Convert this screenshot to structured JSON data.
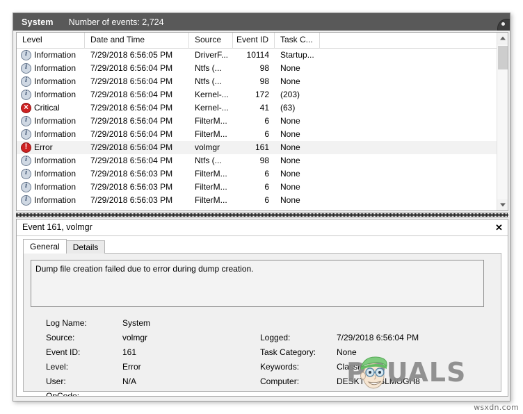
{
  "window": {
    "header": {
      "log_name": "System",
      "events_count_label": "Number of events: 2,724",
      "orb_icon": "dark-circle-icon"
    }
  },
  "events_list": {
    "columns": [
      {
        "key": "level",
        "label": "Level"
      },
      {
        "key": "date",
        "label": "Date and Time"
      },
      {
        "key": "source",
        "label": "Source"
      },
      {
        "key": "eid",
        "label": "Event ID"
      },
      {
        "key": "task",
        "label": "Task C..."
      }
    ],
    "rows": [
      {
        "level": "Information",
        "icon": "information-icon",
        "date": "7/29/2018 6:56:05 PM",
        "source": "DriverF...",
        "eid": "10114",
        "task": "Startup...",
        "selected": false
      },
      {
        "level": "Information",
        "icon": "information-icon",
        "date": "7/29/2018 6:56:04 PM",
        "source": "Ntfs (...",
        "eid": "98",
        "task": "None",
        "selected": false
      },
      {
        "level": "Information",
        "icon": "information-icon",
        "date": "7/29/2018 6:56:04 PM",
        "source": "Ntfs (...",
        "eid": "98",
        "task": "None",
        "selected": false
      },
      {
        "level": "Information",
        "icon": "information-icon",
        "date": "7/29/2018 6:56:04 PM",
        "source": "Kernel-...",
        "eid": "172",
        "task": "(203)",
        "selected": false
      },
      {
        "level": "Critical",
        "icon": "critical-icon",
        "date": "7/29/2018 6:56:04 PM",
        "source": "Kernel-...",
        "eid": "41",
        "task": "(63)",
        "selected": false
      },
      {
        "level": "Information",
        "icon": "information-icon",
        "date": "7/29/2018 6:56:04 PM",
        "source": "FilterM...",
        "eid": "6",
        "task": "None",
        "selected": false
      },
      {
        "level": "Information",
        "icon": "information-icon",
        "date": "7/29/2018 6:56:04 PM",
        "source": "FilterM...",
        "eid": "6",
        "task": "None",
        "selected": false
      },
      {
        "level": "Error",
        "icon": "error-icon",
        "date": "7/29/2018 6:56:04 PM",
        "source": "volmgr",
        "eid": "161",
        "task": "None",
        "selected": true
      },
      {
        "level": "Information",
        "icon": "information-icon",
        "date": "7/29/2018 6:56:04 PM",
        "source": "Ntfs (...",
        "eid": "98",
        "task": "None",
        "selected": false
      },
      {
        "level": "Information",
        "icon": "information-icon",
        "date": "7/29/2018 6:56:03 PM",
        "source": "FilterM...",
        "eid": "6",
        "task": "None",
        "selected": false
      },
      {
        "level": "Information",
        "icon": "information-icon",
        "date": "7/29/2018 6:56:03 PM",
        "source": "FilterM...",
        "eid": "6",
        "task": "None",
        "selected": false
      },
      {
        "level": "Information",
        "icon": "information-icon",
        "date": "7/29/2018 6:56:03 PM",
        "source": "FilterM...",
        "eid": "6",
        "task": "None",
        "selected": false
      }
    ]
  },
  "detail": {
    "title": "Event 161, volmgr",
    "close_label": "✕",
    "tabs": [
      {
        "label": "General",
        "active": true
      },
      {
        "label": "Details",
        "active": false
      }
    ],
    "message": "Dump file creation failed due to error during dump creation.",
    "properties_left": [
      {
        "label": "Log Name:",
        "value": "System"
      },
      {
        "label": "Source:",
        "value": "volmgr"
      },
      {
        "label": "Event ID:",
        "value": "161"
      },
      {
        "label": "Level:",
        "value": "Error"
      },
      {
        "label": "User:",
        "value": "N/A"
      },
      {
        "label": "OpCode:",
        "value": ""
      }
    ],
    "properties_right": [
      {
        "label": "",
        "value": ""
      },
      {
        "label": "Logged:",
        "value": "7/29/2018 6:56:04 PM"
      },
      {
        "label": "Task Category:",
        "value": "None"
      },
      {
        "label": "Keywords:",
        "value": "Classic"
      },
      {
        "label": "Computer:",
        "value": "DESKTOP-BLMOGH8"
      },
      {
        "label": "",
        "value": ""
      }
    ]
  },
  "watermark": {
    "text": "PPUALS",
    "mascot_icon": "appuals-mascot-icon",
    "color": "#8a8a8a"
  },
  "credit": {
    "text": "wsxdn.com"
  }
}
